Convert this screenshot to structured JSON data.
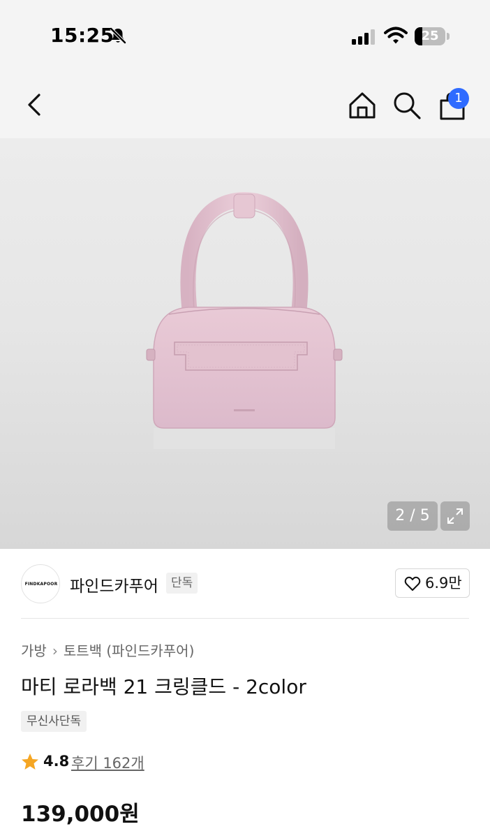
{
  "status_bar": {
    "time": "15:25",
    "battery": "25",
    "battery_level_percent": 25,
    "icons": [
      "bell-muted-icon",
      "cellular-signal-icon",
      "wifi-icon",
      "battery-icon"
    ]
  },
  "nav": {
    "icons": [
      "back-chevron-icon",
      "home-icon",
      "search-icon",
      "shopping-bag-icon"
    ],
    "cart_count": "1"
  },
  "gallery": {
    "counter": "2 / 5",
    "current_index": 2,
    "total": 5,
    "expand_icon": "expand-icon",
    "product_color_hex": "#e3c3d0"
  },
  "brand": {
    "logo_text": "FINDKAPOOR",
    "name": "파인드카푸어",
    "tag": "단독",
    "likes": "6.9만",
    "like_icon": "heart-outline-icon"
  },
  "product": {
    "breadcrumb": [
      "가방",
      "토트백 (파인드카푸어)"
    ],
    "breadcrumb_separator_icon": "chevron-right-icon",
    "title": "마티 로라백 21 크링클드 - 2color",
    "store_tag": "무신사단독",
    "rating": "4.8",
    "rating_icon": "star-icon",
    "rating_color": "#f5a623",
    "reviews": "후기 162개",
    "price": "139,000원"
  },
  "colors": {
    "badge_blue": "#2f6bff",
    "header_bg": "#f4f4f4"
  }
}
